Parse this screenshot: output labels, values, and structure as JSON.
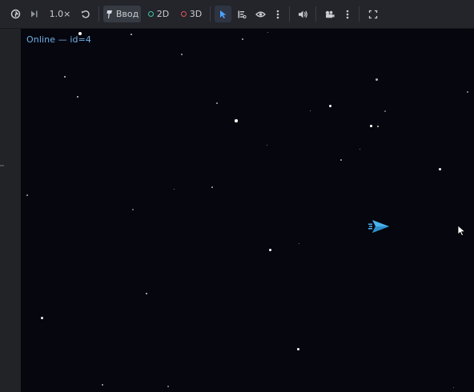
{
  "toolbar": {
    "speed_label": "1.0×",
    "input_label": "Ввод",
    "mode_2d_label": "2D",
    "mode_3d_label": "3D",
    "icons": [
      "remote-icon",
      "step-frame-icon",
      "reset-icon",
      "input-icon",
      "select-icon",
      "list-icon",
      "eye-icon",
      "more-icon",
      "audio-icon",
      "camera-icon",
      "more-icon",
      "fullscreen-icon"
    ],
    "colors": {
      "mode_2d": "#3ec6a8",
      "mode_3d": "#e05555",
      "select_active": "#4aa3ff"
    }
  },
  "viewport": {
    "status_text": "Online — id=4",
    "background": "#06060e",
    "player_ship_color": "#4ab3ee"
  }
}
